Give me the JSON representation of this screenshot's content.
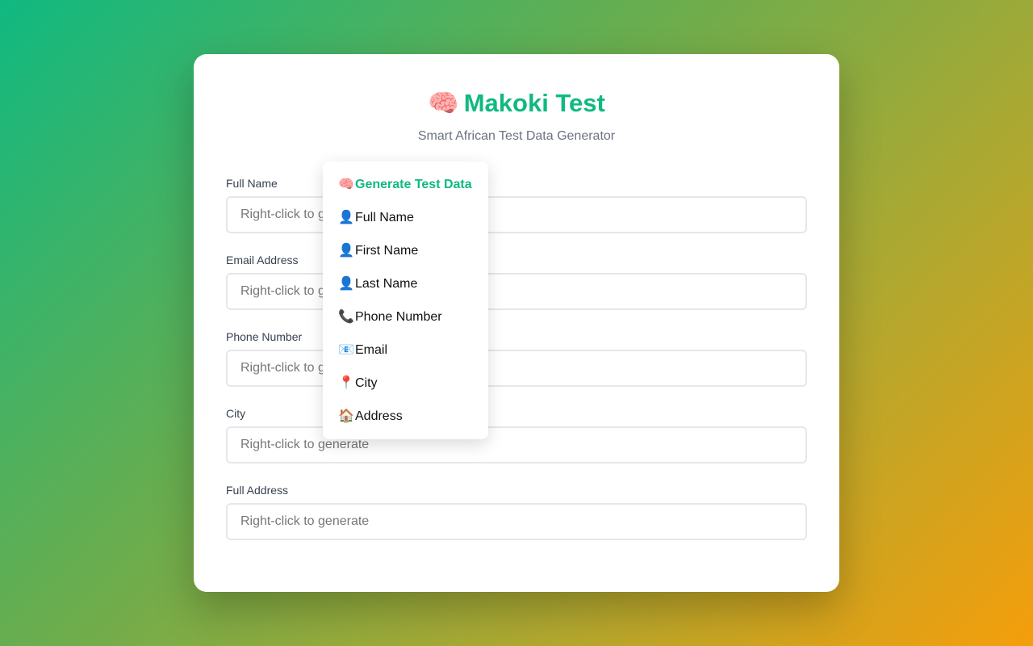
{
  "header": {
    "icon": "brain-icon",
    "icon_glyph": "🧠",
    "title": "Makoki Test",
    "subtitle": "Smart African Test Data Generator"
  },
  "fields": [
    {
      "label": "Full Name",
      "placeholder": "Right-click to generate"
    },
    {
      "label": "Email Address",
      "placeholder": "Right-click to generate"
    },
    {
      "label": "Phone Number",
      "placeholder": "Right-click to generate"
    },
    {
      "label": "City",
      "placeholder": "Right-click to generate"
    },
    {
      "label": "Full Address",
      "placeholder": "Right-click to generate"
    }
  ],
  "context_menu": {
    "header": {
      "icon": "brain-icon",
      "glyph": "🧠",
      "label": "Generate Test Data"
    },
    "items": [
      {
        "icon": "person-icon",
        "glyph": "👤",
        "label": "Full Name"
      },
      {
        "icon": "person-icon",
        "glyph": "👤",
        "label": "First Name"
      },
      {
        "icon": "person-icon",
        "glyph": "👤",
        "label": "Last Name"
      },
      {
        "icon": "phone-icon",
        "glyph": "📞",
        "label": "Phone Number"
      },
      {
        "icon": "email-icon",
        "glyph": "📧",
        "label": "Email"
      },
      {
        "icon": "pin-icon",
        "glyph": "📍",
        "label": "City"
      },
      {
        "icon": "house-icon",
        "glyph": "🏠",
        "label": "Address"
      }
    ]
  },
  "colors": {
    "accent": "#10b981",
    "background_start": "#10b981",
    "background_end": "#f59e0b"
  }
}
